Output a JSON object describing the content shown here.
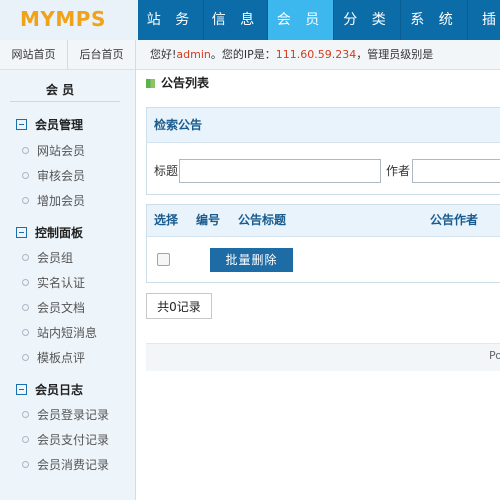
{
  "logo": "MYMPS",
  "nav": [
    "站 务",
    "信 息",
    "会 员",
    "分 类",
    "系 统",
    "插"
  ],
  "subnav": [
    "网站首页",
    "后台首页"
  ],
  "welcome": {
    "prefix": "您好!",
    "user": "admin",
    "ip_label": "。您的IP是：",
    "ip": "111.60.59.234",
    "suffix": "，管理员级别是"
  },
  "sidebar": {
    "title": "会 员",
    "groups": [
      {
        "label": "会员管理",
        "items": [
          "网站会员",
          "审核会员",
          "增加会员"
        ]
      },
      {
        "label": "控制面板",
        "items": [
          "会员组",
          "实名认证",
          "会员文档",
          "站内短消息",
          "模板点评"
        ]
      },
      {
        "label": "会员日志",
        "items": [
          "会员登录记录",
          "会员支付记录",
          "会员消费记录"
        ]
      }
    ]
  },
  "breadcrumb": "公告列表",
  "search": {
    "heading": "检索公告",
    "title_label": "标题",
    "author_label": "作者",
    "title_value": "",
    "author_value": ""
  },
  "table": {
    "headers": [
      "选择",
      "编号",
      "公告标题",
      "公告作者"
    ],
    "batch_delete": "批量删除"
  },
  "record_count": "共0记录",
  "footer": "Po",
  "colors": {
    "nav_bg": "#0c6ca8",
    "nav_active": "#3db8ee",
    "logo": "#f0a21a",
    "button": "#1d6ca6",
    "highlight": "#d63b1c"
  }
}
